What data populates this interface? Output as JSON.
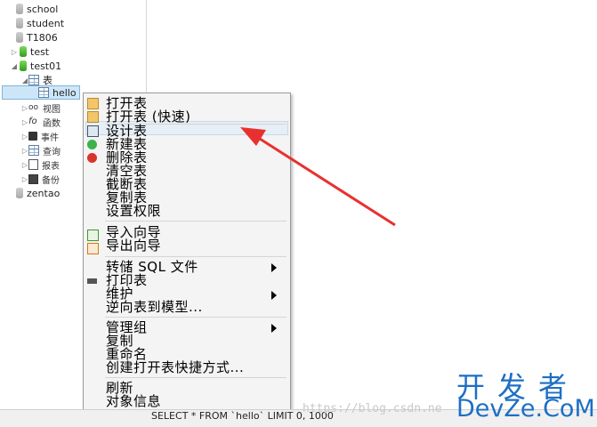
{
  "tree": {
    "school": "school",
    "student": "student",
    "t1806": "T1806",
    "test": "test",
    "test01": "test01",
    "tables_group": "表",
    "hello": "hello",
    "views": "视图",
    "functions": "函数",
    "events": "事件",
    "queries": "查询",
    "reports": "报表",
    "backups": "备份",
    "zentao": "zentao"
  },
  "context_menu": {
    "open_table": "打开表",
    "open_table_fast": "打开表 (快速)",
    "design_table": "设计表",
    "new_table": "新建表",
    "delete_table": "删除表",
    "empty_table": "清空表",
    "truncate_table": "截断表",
    "copy_table": "复制表",
    "set_permissions": "设置权限",
    "import_wizard": "导入向导",
    "export_wizard": "导出向导",
    "dump_sql": "转储 SQL 文件",
    "print_table": "打印表",
    "maintain": "维护",
    "reverse_model": "逆向表到模型...",
    "manage_group": "管理组",
    "copy": "复制",
    "rename": "重命名",
    "create_shortcut": "创建打开表快捷方式...",
    "refresh": "刷新",
    "object_info": "对象信息"
  },
  "status": {
    "sql": "SELECT * FROM `hello` LIMIT 0, 1000"
  },
  "overlay": {
    "watermark": "https://blog.csdn.ne",
    "brand_cn": "开发者",
    "brand_en": "DevZe.CoM"
  },
  "colors": {
    "arrow": "#e8312f",
    "brand": "#1d6fc5",
    "selection": "#cde6f7"
  }
}
